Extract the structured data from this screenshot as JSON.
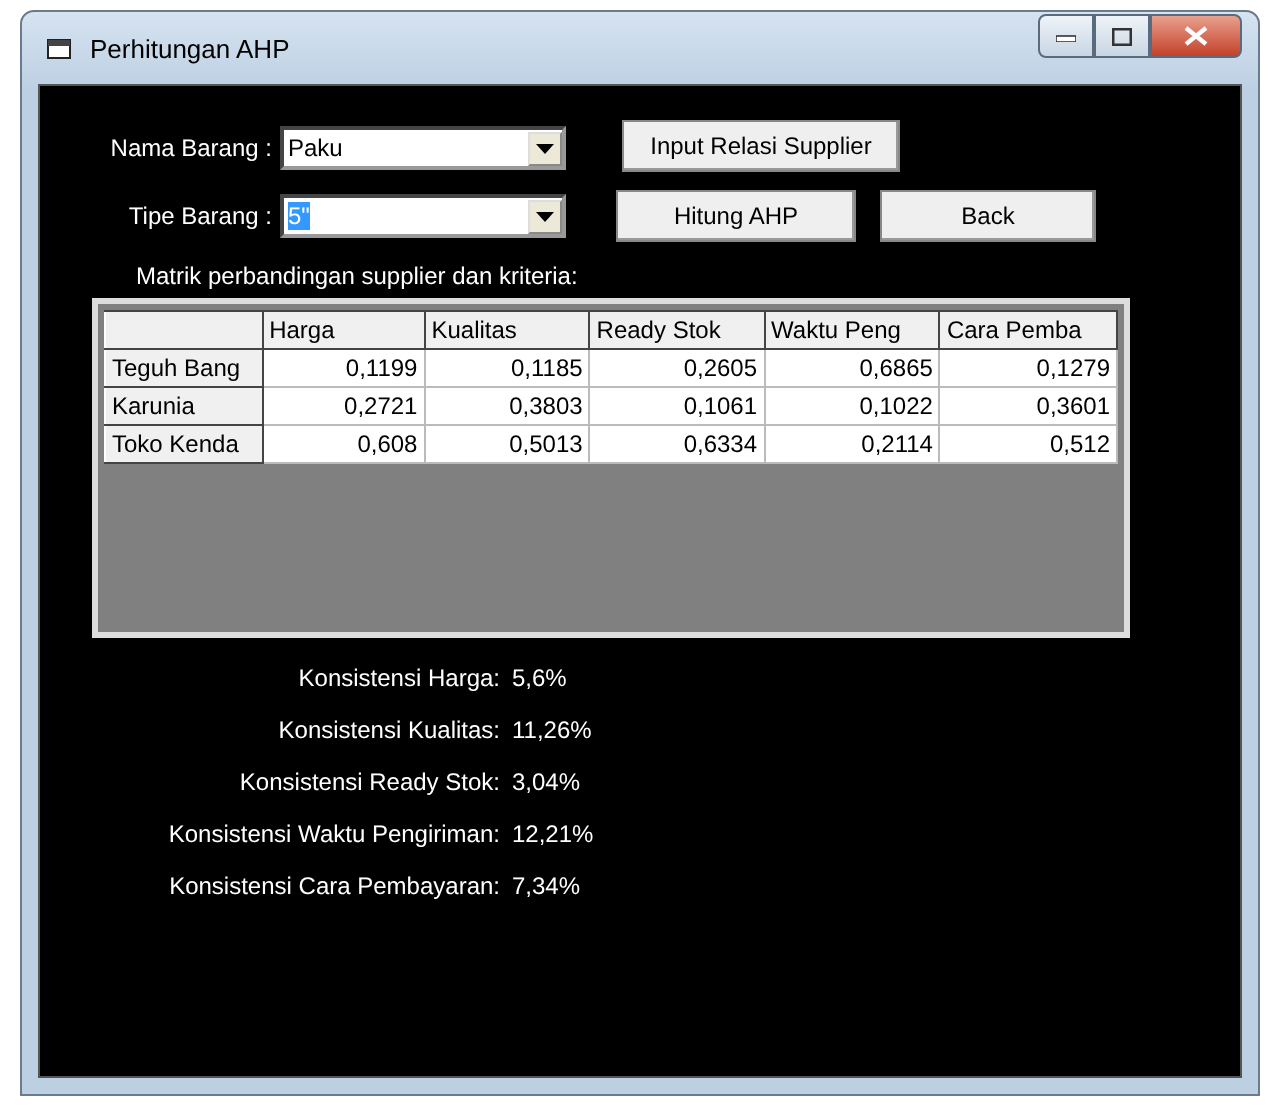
{
  "window": {
    "title": "Perhitungan AHP"
  },
  "fields": [
    {
      "label": "Nama Barang :",
      "value": "Paku",
      "highlighted": false
    },
    {
      "label": "Tipe Barang :",
      "value": "5\"",
      "highlighted": true
    }
  ],
  "buttons": [
    "Input Relasi Supplier",
    "Hitung AHP",
    "Back"
  ],
  "matrix_caption": "Matrik perbandingan supplier dan kriteria:",
  "table": {
    "columns": [
      "Harga",
      "Kualitas",
      "Ready Stok",
      "Waktu Peng",
      "Cara Pemba"
    ],
    "rows": [
      {
        "name": "Teguh Bang",
        "cells": [
          "0,1199",
          "0,1185",
          "0,2605",
          "0,6865",
          "0,1279"
        ]
      },
      {
        "name": "Karunia",
        "cells": [
          "0,2721",
          "0,3803",
          "0,1061",
          "0,1022",
          "0,3601"
        ]
      },
      {
        "name": "Toko Kenda",
        "cells": [
          "0,608",
          "0,5013",
          "0,6334",
          "0,2114",
          "0,512"
        ]
      }
    ]
  },
  "consistency": [
    {
      "label": "Konsistensi Harga:",
      "value": "5,6%"
    },
    {
      "label": "Konsistensi Kualitas:",
      "value": "11,26%"
    },
    {
      "label": "Konsistensi Ready Stok:",
      "value": "3,04%"
    },
    {
      "label": "Konsistensi Waktu Pengiriman:",
      "value": "12,21%"
    },
    {
      "label": "Konsistensi Cara Pembayaran:",
      "value": "7,34%"
    }
  ]
}
